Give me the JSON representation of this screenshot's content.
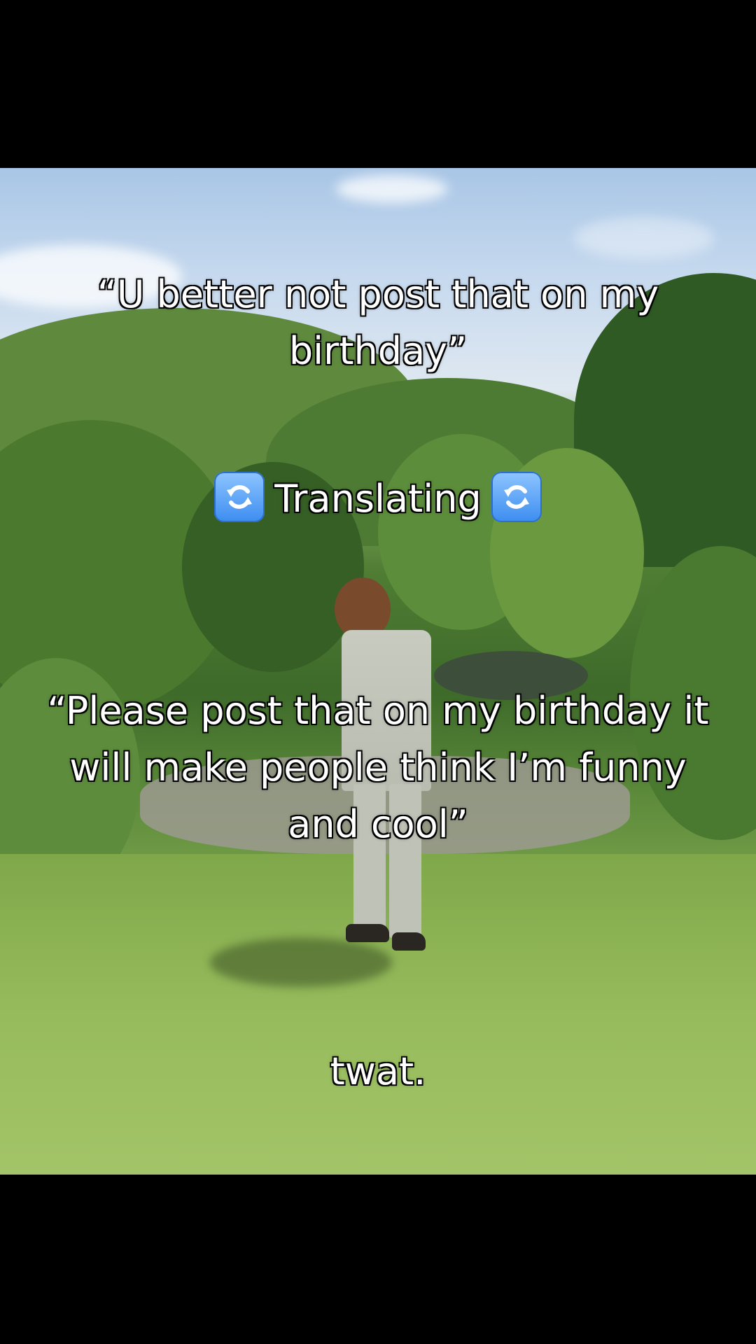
{
  "captions": {
    "line1": "“U better not post that on my birthday”",
    "translating": "Translating",
    "line2": "“Please post that on my birthday it will make people think I’m funny and cool”",
    "line3": "twat."
  },
  "icons": {
    "translating_left": "counterclockwise-arrows-icon",
    "translating_right": "counterclockwise-arrows-icon"
  },
  "colors": {
    "letterbox": "#000000",
    "caption_text": "#ffffff",
    "emoji_blue": "#3c8df0"
  }
}
